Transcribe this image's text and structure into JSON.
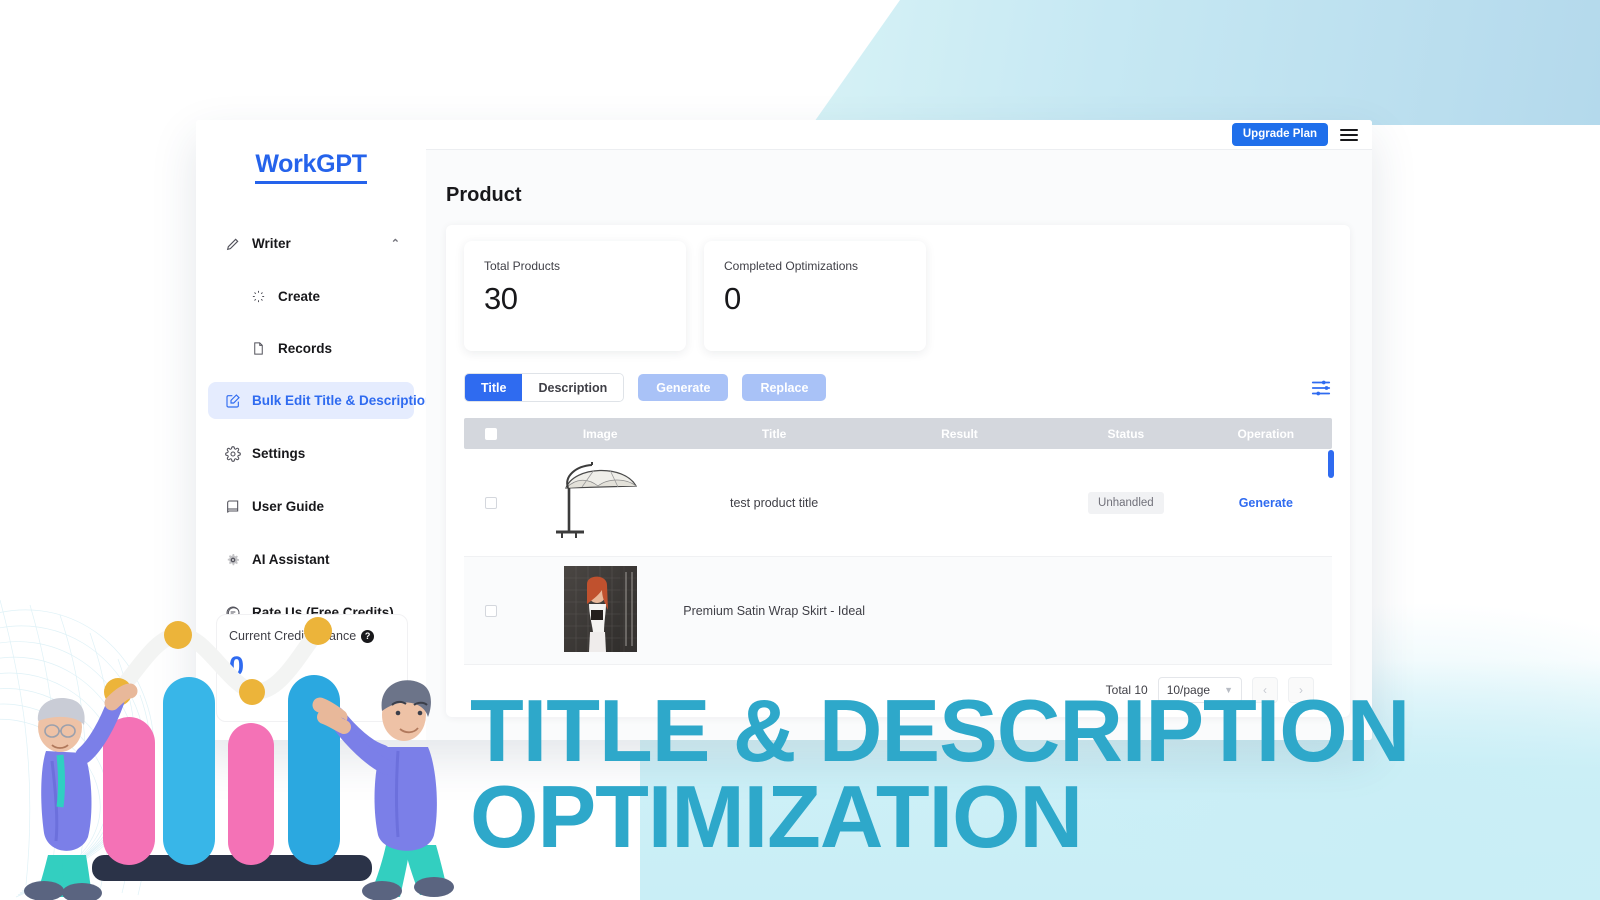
{
  "brand": {
    "name_prefix": "Work",
    "name_suffix": "GPT",
    "full": "WorkGPT"
  },
  "sidebar": {
    "items": [
      {
        "label": "Writer",
        "icon": "pencil-icon",
        "level": "top",
        "active": false,
        "chevron": "⌃"
      },
      {
        "label": "Create",
        "icon": "sparkle-icon",
        "level": "sub",
        "active": false
      },
      {
        "label": "Records",
        "icon": "document-icon",
        "level": "sub",
        "active": false
      },
      {
        "label": "Bulk Edit Title & Description",
        "icon": "edit-square-icon",
        "level": "top",
        "active": true
      },
      {
        "label": "Settings",
        "icon": "gear-icon",
        "level": "top",
        "active": false
      },
      {
        "label": "User Guide",
        "icon": "book-icon",
        "level": "top",
        "active": false
      },
      {
        "label": "AI Assistant",
        "icon": "cog-icon",
        "level": "top",
        "active": false
      },
      {
        "label": "Rate Us (Free Credits)",
        "icon": "chat-icon",
        "level": "top",
        "active": false
      }
    ],
    "credit": {
      "label": "Current Credit Balance",
      "help_icon": "question-mark-icon",
      "value": "0"
    }
  },
  "topbar": {
    "upgrade_label": "Upgrade Plan",
    "menu_icon": "hamburger-menu-icon"
  },
  "page": {
    "title": "Product"
  },
  "stats": [
    {
      "label": "Total Products",
      "value": "30"
    },
    {
      "label": "Completed Optimizations",
      "value": "0"
    }
  ],
  "toolbar": {
    "tabs": [
      {
        "label": "Title",
        "active": true
      },
      {
        "label": "Description",
        "active": false
      }
    ],
    "actions": [
      {
        "label": "Generate",
        "disabled": true
      },
      {
        "label": "Replace",
        "disabled": true
      }
    ],
    "filter_icon": "sliders-filter-icon"
  },
  "table": {
    "columns": [
      "",
      "Image",
      "Title",
      "Result",
      "Status",
      "Operation"
    ],
    "rows": [
      {
        "image_alt": "patio-cantilever-umbrella-thumbnail",
        "title": "test product title",
        "result": "",
        "status": "Unhandled",
        "operation": "Generate"
      },
      {
        "image_alt": "woman-wearing-satin-wrap-skirt-thumbnail",
        "title": "Premium Satin Wrap Skirt - Ideal",
        "result": "",
        "status": "",
        "operation": ""
      }
    ]
  },
  "pagination": {
    "total_label": "Total 10",
    "page_size": "10/page",
    "prev_icon": "chevron-left-icon",
    "next_icon": "chevron-right-icon"
  },
  "overlay_caption": {
    "line1": "TITLE & DESCRIPTION",
    "line2": "OPTIMIZATION"
  },
  "colors": {
    "brand_blue": "#2563eb",
    "accent_blue": "#2f6bf0",
    "upgrade_blue": "#1f6feb",
    "disabled_blue": "#a9c2f7",
    "active_nav_bg": "#e5ecfe",
    "table_header_bg": "#d4d7dd",
    "caption_cyan": "#2ea8ca",
    "status_badge_bg": "#f1f2f4"
  },
  "illustration": {
    "name": "3d-people-with-bar-chart-illustration",
    "bars": [
      "#f472b6",
      "#38b6e8",
      "#f472b6",
      "#2ba8e0"
    ]
  }
}
